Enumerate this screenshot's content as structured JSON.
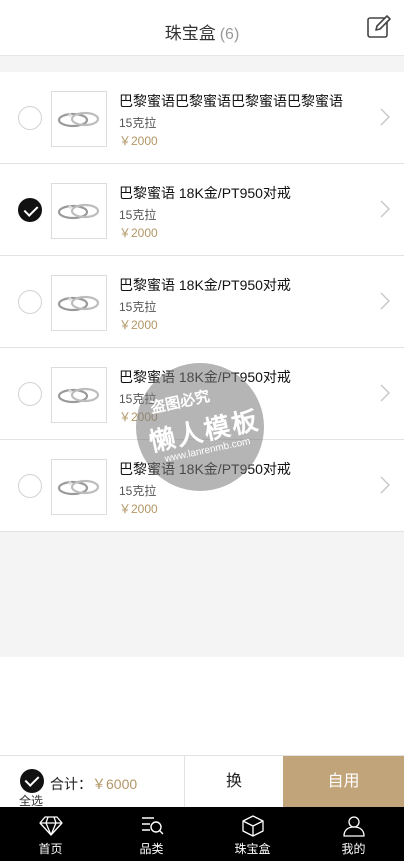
{
  "header": {
    "title": "珠宝盒",
    "count": "(6)"
  },
  "items": [
    {
      "name": "巴黎蜜语巴黎蜜语巴黎蜜语巴黎蜜语",
      "weight": "15克拉",
      "price": "￥2000",
      "checked": false
    },
    {
      "name": "巴黎蜜语 18K金/PT950对戒",
      "weight": "15克拉",
      "price": "￥2000",
      "checked": true
    },
    {
      "name": "巴黎蜜语 18K金/PT950对戒",
      "weight": "15克拉",
      "price": "￥2000",
      "checked": false
    },
    {
      "name": "巴黎蜜语 18K金/PT950对戒",
      "weight": "15克拉",
      "price": "￥2000",
      "checked": false
    },
    {
      "name": "巴黎蜜语 18K金/PT950对戒",
      "weight": "15克拉",
      "price": "￥2000",
      "checked": false
    }
  ],
  "watermark": {
    "line1": "盗图必究",
    "line2": "懒人模板",
    "line3": "www.lanrenmb.com"
  },
  "bottom": {
    "select_all_label": "全选",
    "total_label": "合计：",
    "total_value": "￥6000",
    "exchange_label": "换",
    "use_label": "自用"
  },
  "tabs": [
    {
      "label": "首页",
      "icon": "diamond-icon"
    },
    {
      "label": "品类",
      "icon": "category-search-icon"
    },
    {
      "label": "珠宝盒",
      "icon": "box-icon"
    },
    {
      "label": "我的",
      "icon": "user-icon"
    }
  ],
  "colors": {
    "accent": "#c2a47a",
    "price": "#b39666",
    "tabbar": "#000000"
  }
}
